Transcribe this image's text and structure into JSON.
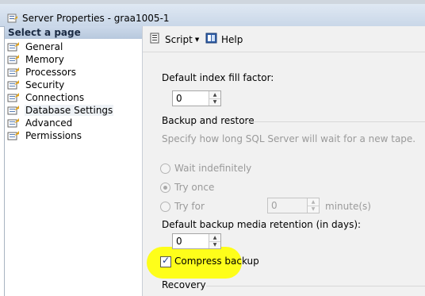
{
  "window": {
    "title": "Server Properties - graa1005-1"
  },
  "sidebar": {
    "header": "Select a page",
    "items": [
      {
        "label": "General"
      },
      {
        "label": "Memory"
      },
      {
        "label": "Processors"
      },
      {
        "label": "Security"
      },
      {
        "label": "Connections"
      },
      {
        "label": "Database Settings",
        "selected": true
      },
      {
        "label": "Advanced"
      },
      {
        "label": "Permissions"
      }
    ]
  },
  "toolbar": {
    "script_label": "Script",
    "help_label": "Help"
  },
  "settings": {
    "fill_factor_label": "Default index fill factor:",
    "fill_factor_value": "0",
    "backup_restore_label": "Backup and restore",
    "backup_desc": "Specify how long SQL Server will wait for a new tape.",
    "wait_indefinitely_label": "Wait indefinitely",
    "try_once_label": "Try once",
    "try_for_label": "Try for",
    "try_for_value": "0",
    "minutes_label": "minute(s)",
    "retention_label": "Default backup media retention (in days):",
    "retention_value": "0",
    "compress_backup_label": "Compress backup",
    "compress_backup_checked": true,
    "recovery_label": "Recovery"
  },
  "colors": {
    "highlight": "#fefe1a",
    "title_bar": "#dfe8f3"
  }
}
